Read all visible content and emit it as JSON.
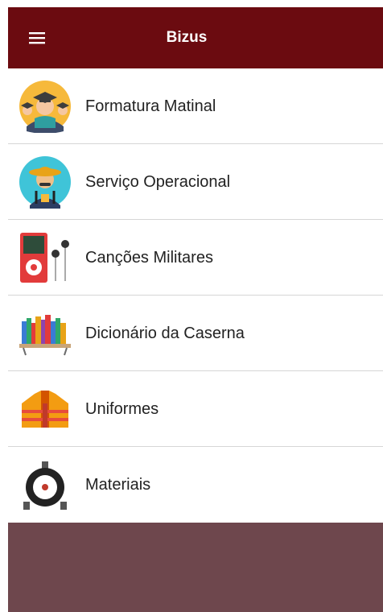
{
  "appbar": {
    "title": "Bizus",
    "menu_icon": "hamburger-menu-icon"
  },
  "items": [
    {
      "label": "Formatura Matinal",
      "icon": "graduates-icon"
    },
    {
      "label": "Serviço Operacional",
      "icon": "soldier-icon"
    },
    {
      "label": "Canções Militares",
      "icon": "music-player-icon"
    },
    {
      "label": "Dicionário da Caserna",
      "icon": "bookshelf-icon"
    },
    {
      "label": "Uniformes",
      "icon": "jacket-icon"
    },
    {
      "label": "Materiais",
      "icon": "reel-icon"
    }
  ],
  "colors": {
    "appbar": "#6b0b10",
    "backdrop": "#6e474d",
    "list_bg": "#ffffff"
  }
}
